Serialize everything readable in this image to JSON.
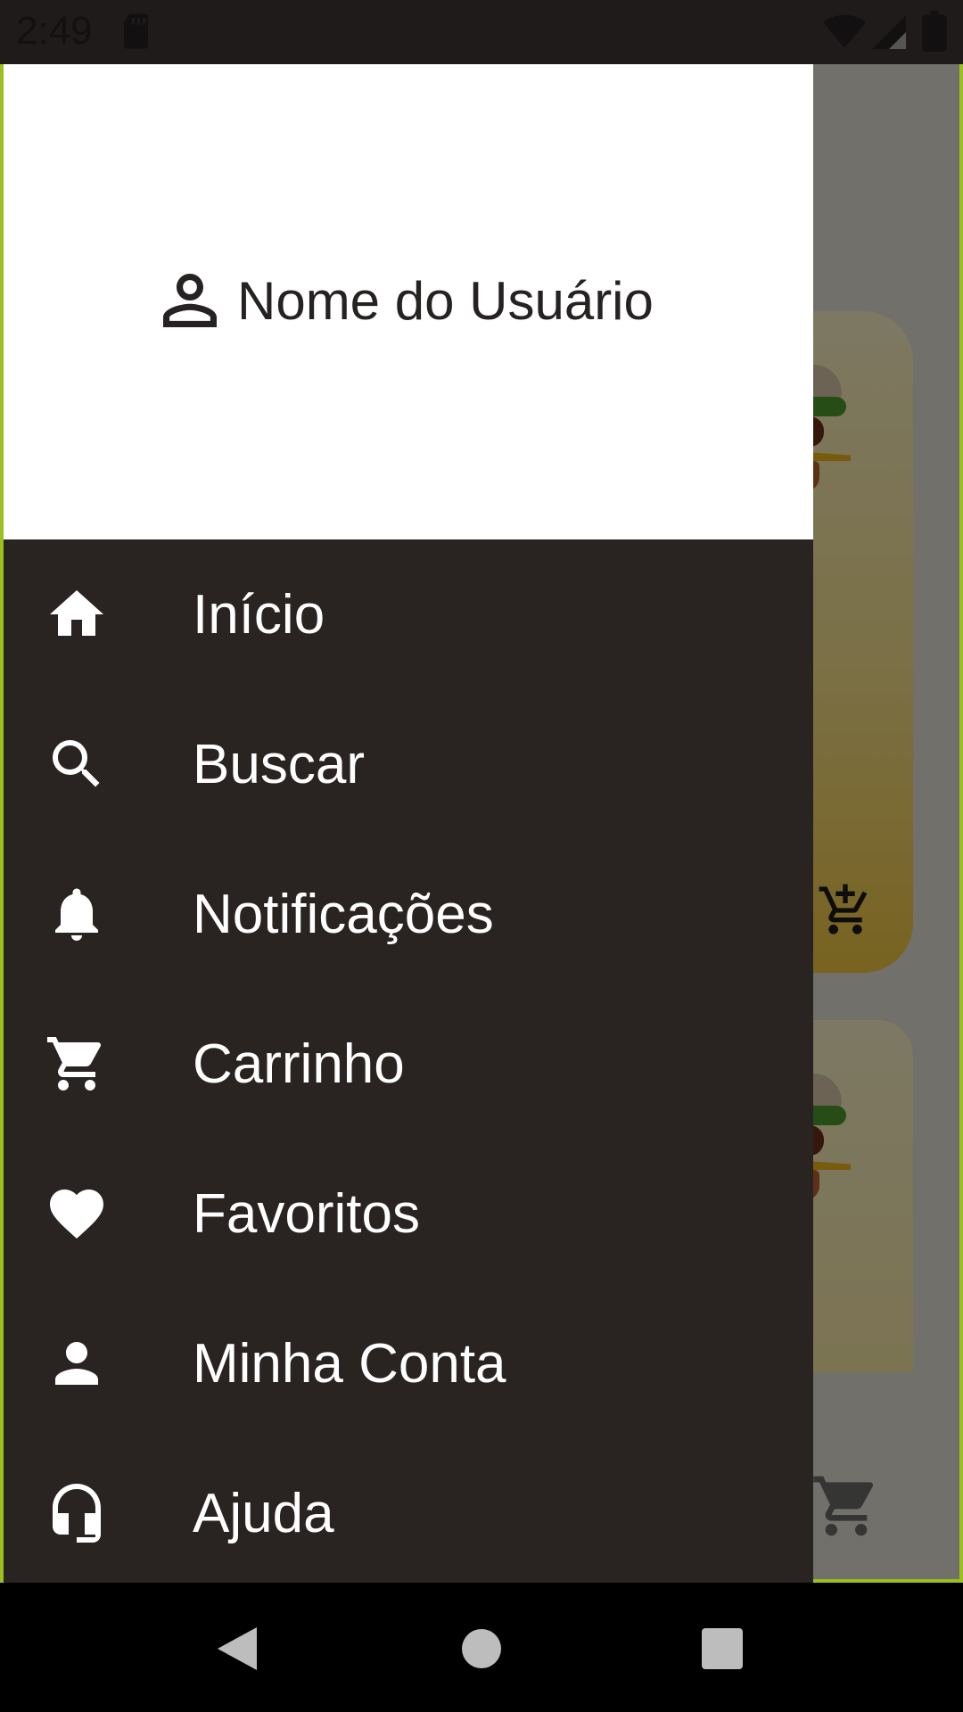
{
  "status_bar": {
    "time": "2:49",
    "icons": [
      "sd-card-icon",
      "wifi-icon",
      "signal-icon",
      "battery-icon"
    ]
  },
  "drawer": {
    "header": {
      "user_icon": "person-outline-icon",
      "user_name": "Nome do Usuário"
    },
    "items": [
      {
        "icon": "home-icon",
        "label": "Início"
      },
      {
        "icon": "search-icon",
        "label": "Buscar"
      },
      {
        "icon": "bell-icon",
        "label": "Notificações"
      },
      {
        "icon": "cart-icon",
        "label": "Carrinho"
      },
      {
        "icon": "heart-icon",
        "label": "Favoritos"
      },
      {
        "icon": "person-icon",
        "label": "Minha Conta"
      },
      {
        "icon": "headset-icon",
        "label": "Ajuda"
      }
    ]
  },
  "background_app": {
    "cards": [
      {
        "image": "burger-image",
        "action_icon": "add-to-cart-icon"
      },
      {
        "image": "burger-image"
      }
    ],
    "cart_icon": "cart-icon"
  },
  "nav_bar": {
    "buttons": [
      "back-icon",
      "home-circle-icon",
      "recents-square-icon"
    ]
  },
  "colors": {
    "drawer_bg": "#292322",
    "header_bg": "#ffffff",
    "accent_border": "#9bbf1f",
    "status_bar_bg": "#1f1b1b",
    "nav_bar_bg": "#000000"
  }
}
